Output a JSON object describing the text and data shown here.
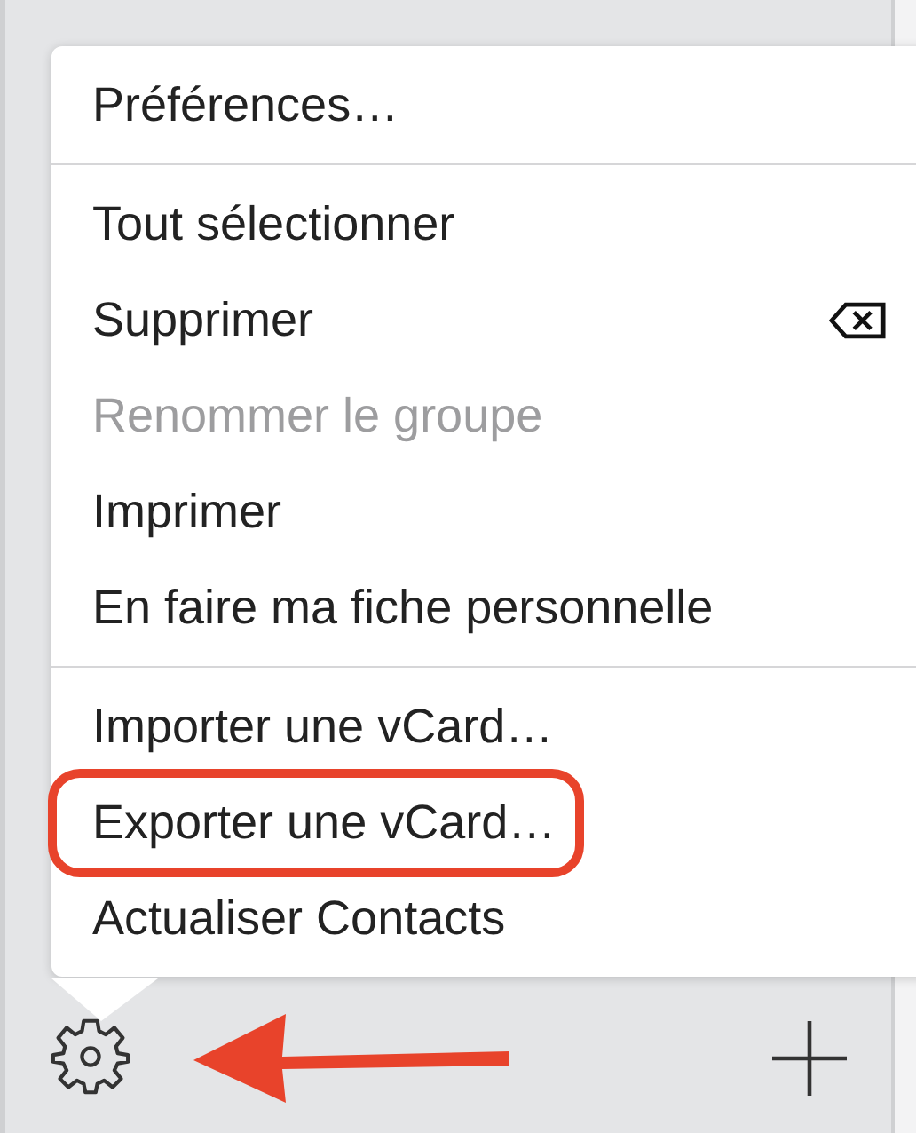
{
  "menu": {
    "groups": [
      {
        "items": [
          {
            "label": "Préférences…",
            "disabled": false,
            "delete_key": false,
            "highlighted": false
          }
        ]
      },
      {
        "items": [
          {
            "label": "Tout sélectionner",
            "disabled": false,
            "delete_key": false,
            "highlighted": false
          },
          {
            "label": "Supprimer",
            "disabled": false,
            "delete_key": true,
            "highlighted": false
          },
          {
            "label": "Renommer le groupe",
            "disabled": true,
            "delete_key": false,
            "highlighted": false
          },
          {
            "label": "Imprimer",
            "disabled": false,
            "delete_key": false,
            "highlighted": false
          },
          {
            "label": "En faire ma fiche personnelle",
            "disabled": false,
            "delete_key": false,
            "highlighted": false
          }
        ]
      },
      {
        "items": [
          {
            "label": "Importer une vCard…",
            "disabled": false,
            "delete_key": false,
            "highlighted": false
          },
          {
            "label": "Exporter une vCard…",
            "disabled": false,
            "delete_key": false,
            "highlighted": true
          },
          {
            "label": "Actualiser Contacts",
            "disabled": false,
            "delete_key": false,
            "highlighted": false
          }
        ]
      }
    ]
  }
}
